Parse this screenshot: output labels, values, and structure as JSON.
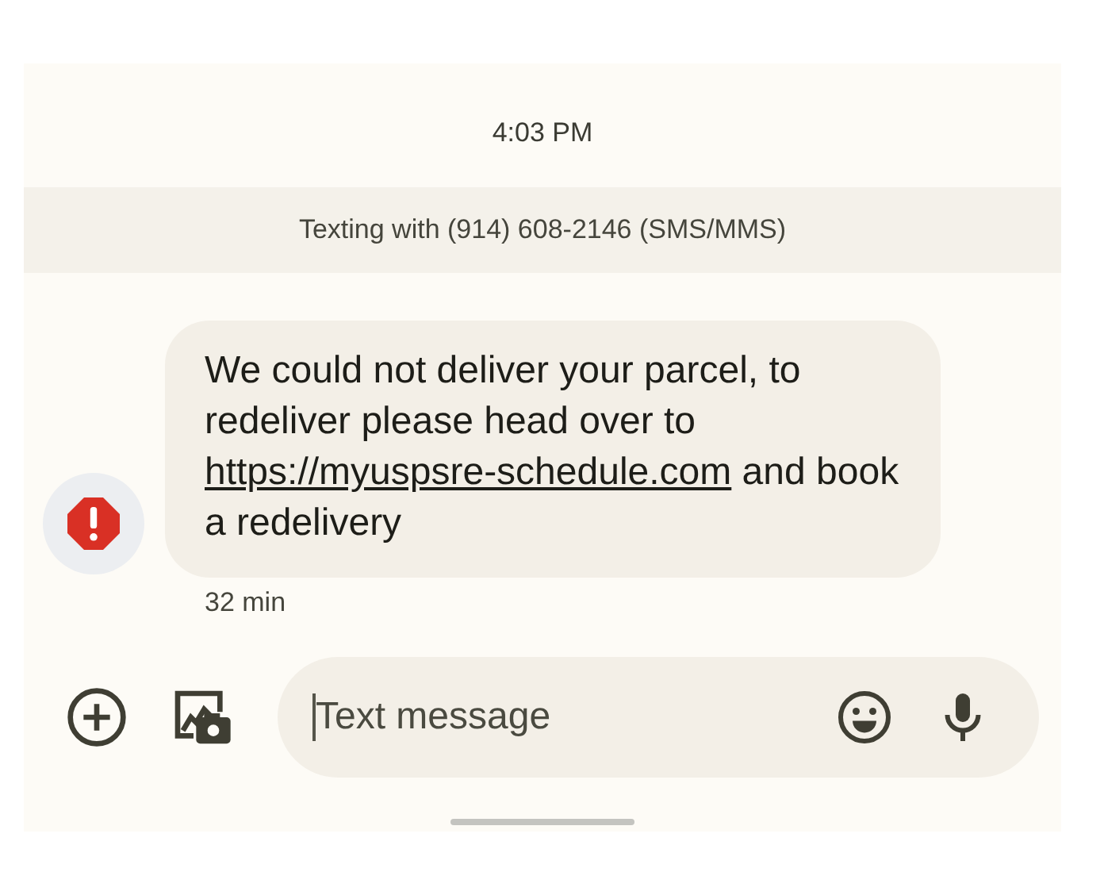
{
  "timestamp": "4:03 PM",
  "banner": "Texting with (914) 608-2146 (SMS/MMS)",
  "messages": [
    {
      "avatar": {
        "kind": "error"
      },
      "parts": [
        {
          "kind": "text",
          "text": "We could not deliver your parcel, to redeliver please head over to "
        },
        {
          "kind": "link",
          "text": "https://myuspsre-schedule.com"
        },
        {
          "kind": "text",
          "text": " and book a redelivery"
        }
      ],
      "time": "32 min"
    }
  ],
  "composer": {
    "placeholder": "Text message",
    "focused": true
  }
}
